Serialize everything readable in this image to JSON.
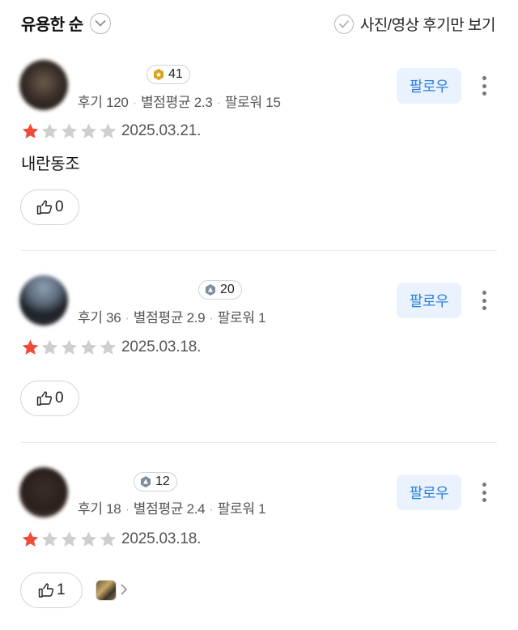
{
  "sort": {
    "label": "유용한 순"
  },
  "photo_filter": {
    "label": "사진/영상 후기만 보기"
  },
  "colors": {
    "star_filled": "#f04a3a",
    "star_empty": "#cfcfcf",
    "follow_text": "#2a7de1",
    "follow_bg": "#eaf2fd",
    "gold_badge": "#d9a21b",
    "gray_badge": "#7f8c9e"
  },
  "reviews": [
    {
      "badge": "41",
      "badge_icon": "gold-hexagon-icon",
      "stats": {
        "reviews": "후기 120",
        "avg": "별점평균 2.3",
        "followers": "팔로워 15"
      },
      "follow": "팔로우",
      "rating": 1,
      "date": "2025.03.21.",
      "text": "내란동조",
      "likes": "0"
    },
    {
      "badge": "20",
      "badge_icon": "gray-hexagon-icon",
      "stats": {
        "reviews": "후기 36",
        "avg": "별점평균 2.9",
        "followers": "팔로워 1"
      },
      "follow": "팔로우",
      "rating": 1,
      "date": "2025.03.18.",
      "text": "",
      "likes": "0"
    },
    {
      "badge": "12",
      "badge_icon": "gray-hexagon-icon",
      "stats": {
        "reviews": "후기 18",
        "avg": "별점평균 2.4",
        "followers": "팔로워 1"
      },
      "follow": "팔로우",
      "rating": 1,
      "date": "2025.03.18.",
      "text": "",
      "likes": "1"
    }
  ]
}
